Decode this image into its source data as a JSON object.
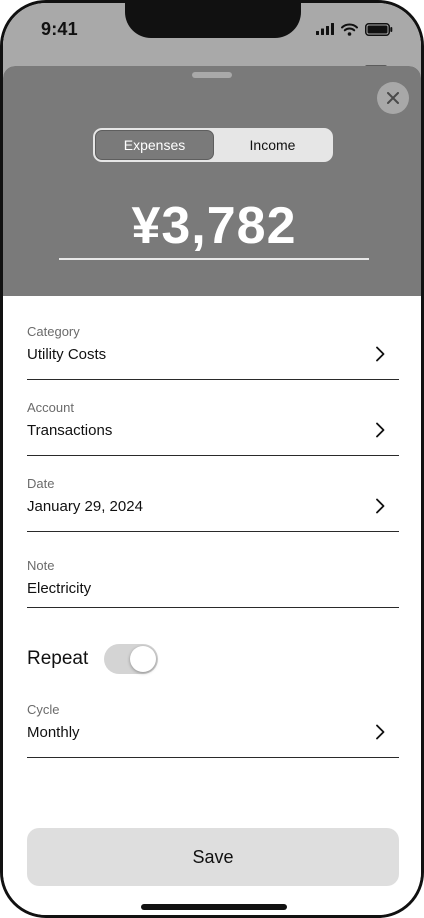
{
  "status_bar": {
    "time": "9:41"
  },
  "segmented": {
    "expenses_label": "Expenses",
    "income_label": "Income",
    "selected": "Expenses"
  },
  "amount": {
    "value": "¥3,782"
  },
  "fields": {
    "category": {
      "label": "Category",
      "value": "Utility Costs"
    },
    "account": {
      "label": "Account",
      "value": "Transactions"
    },
    "date": {
      "label": "Date",
      "value": "January 29, 2024"
    },
    "note": {
      "label": "Note",
      "value": "Electricity"
    },
    "cycle": {
      "label": "Cycle",
      "value": "Monthly"
    }
  },
  "repeat": {
    "label": "Repeat",
    "enabled": true
  },
  "save_label": "Save",
  "icons": {
    "close": "close-icon",
    "chevron": "chevron-right-icon",
    "signal": "cellular-signal-icon",
    "wifi": "wifi-icon",
    "battery": "battery-icon"
  },
  "colors": {
    "sheet_header": "#7a7a7a",
    "toggle_track": "#d4d4d4",
    "save_button": "#dedede"
  }
}
